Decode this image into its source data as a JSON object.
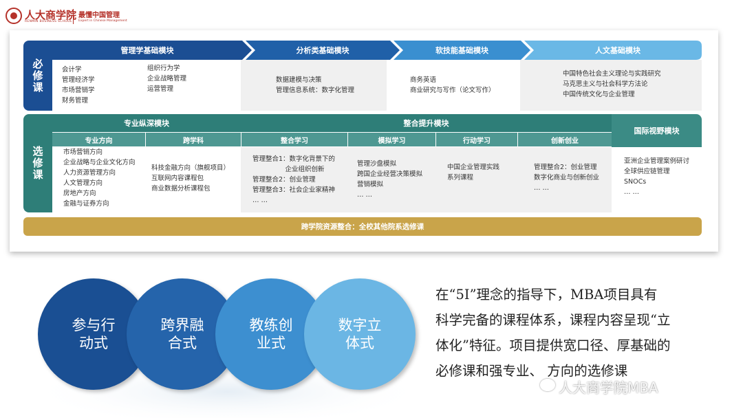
{
  "header": {
    "school_cn": "人大商学院",
    "school_en": "RENMIN BUSINESS SCHOOL",
    "slogan_cn": "最懂中国管理",
    "slogan_en": "Expert in Chinese Management"
  },
  "required": {
    "side_label": [
      "必",
      "修",
      "课"
    ],
    "modules": [
      {
        "title": "管理学基础模块",
        "col1": [
          "会计学",
          "管理经济学",
          "市场营销学",
          "财务管理"
        ],
        "col2": [
          "组织行为学",
          "企业战略管理",
          "运营管理"
        ]
      },
      {
        "title": "分析类基础模块",
        "items": [
          "数据建模与决策",
          "管理信息系统：数字化管理"
        ]
      },
      {
        "title": "软技能基础模块",
        "items": [
          "商务英语",
          "商业研究与写作（论文写作）"
        ]
      },
      {
        "title": "人文基础模块",
        "items": [
          "中国特色社会主义理论与实践研究",
          "马克思主义与社会科学方法论",
          "中国传统文化与企业管理"
        ]
      }
    ]
  },
  "elective": {
    "side_label": [
      "选",
      "修",
      "课"
    ],
    "specialized": {
      "title": "专业纵深模块",
      "sub1": {
        "title": "专业方向",
        "items": [
          "市场营销方向",
          "企业战略与企业文化方向",
          "人力资源管理方向",
          "人文管理方向",
          "房地产方向",
          "金融与证券方向"
        ]
      },
      "sub2": {
        "title": "跨学科",
        "items": [
          "科技金融方向（旗舰项目）",
          "互联网内容课程包",
          "商业数据分析课程包"
        ]
      }
    },
    "integration": {
      "title": "整合提升模块",
      "subs": [
        {
          "title": "整合学习",
          "items": [
            "管理整合1：数字化背景下的",
            "　　　　　企业组织创新",
            "管理整合2：创业管理",
            "管理整合3：社会企业家精神",
            "… …"
          ]
        },
        {
          "title": "模拟学习",
          "items": [
            "管理沙盘模拟",
            "跨国企业经营决策模拟",
            "营销模拟",
            "… …"
          ]
        },
        {
          "title": "行动学习",
          "items": [
            "中国企业管理实践",
            "系列课程"
          ]
        },
        {
          "title": "创新创业",
          "items": [
            "管理整合2：创业管理",
            "数字化商业与创新创业",
            "… …"
          ]
        }
      ]
    },
    "international": {
      "title": "国际视野模块",
      "items": [
        "亚洲企业管理案例研讨",
        "全球供应链管理",
        "SNOCs",
        "… …"
      ]
    }
  },
  "cross_college": "跨学院资源整合：全校其他院系选修课",
  "circles": [
    "参与行\n动式",
    "跨界融\n合式",
    "教练创\n业式",
    "数字立\n体式"
  ],
  "paragraph_lines": [
    "在“5I”理念的指导下，MBA项目具有",
    "科学完备的课程体系，课程内容呈现“立",
    "体化”特征。项目提供宽口径、厚基础的",
    "必修课和强专业、 方向的选修课"
  ],
  "watermark": "人大商学院MBA",
  "colors": {
    "dark_blue": "#1b4e93",
    "mid_blue": "#2779bf",
    "light_blue": "#5fb0e2",
    "teal": "#2e7e78",
    "gold": "#c9a44a"
  }
}
